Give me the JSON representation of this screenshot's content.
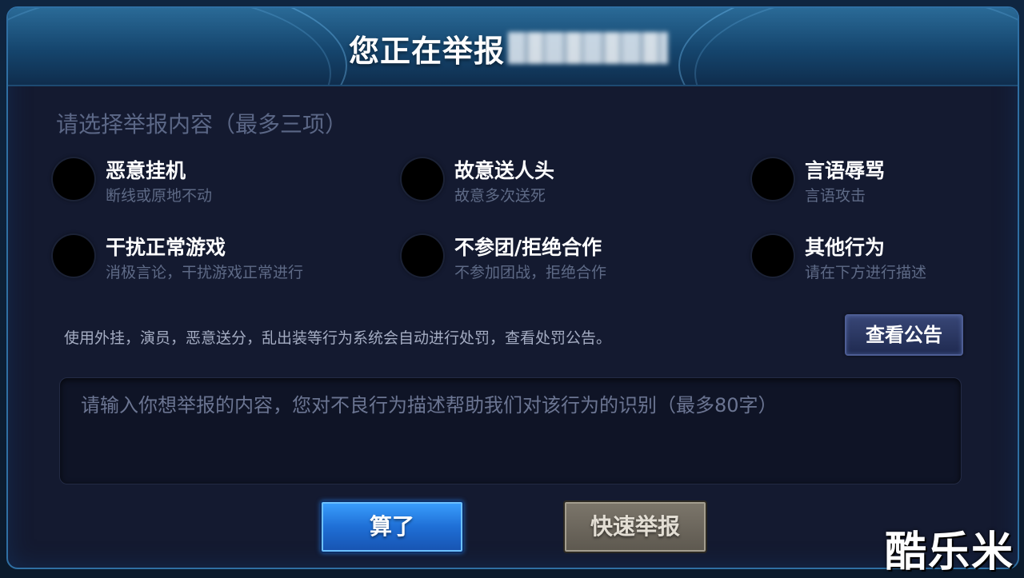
{
  "dialog": {
    "title": "您正在举报",
    "section_title": "请选择举报内容（最多三项）",
    "options": [
      {
        "label": "恶意挂机",
        "desc": "断线或原地不动"
      },
      {
        "label": "故意送人头",
        "desc": "故意多次送死"
      },
      {
        "label": "言语辱骂",
        "desc": "言语攻击"
      },
      {
        "label": "干扰正常游戏",
        "desc": "消极言论，干扰游戏正常进行"
      },
      {
        "label": "不参团/拒绝合作",
        "desc": "不参加团战，拒绝合作"
      },
      {
        "label": "其他行为",
        "desc": "请在下方进行描述"
      }
    ],
    "notice_text": "使用外挂，演员，恶意送分，乱出装等行为系统会自动进行处罚，查看处罚公告。",
    "notice_button": "查看公告",
    "input_placeholder": "请输入你想举报的内容，您对不良行为描述帮助我们对该行为的识别（最多80字）",
    "input_value": "",
    "cancel_button": "算了",
    "submit_button": "快速举报"
  },
  "watermark": "酷乐米",
  "colors": {
    "header": "#15456d",
    "panel": "#141a30",
    "cancel_button": "#1f6fd6",
    "submit_button": "#6b665c"
  }
}
